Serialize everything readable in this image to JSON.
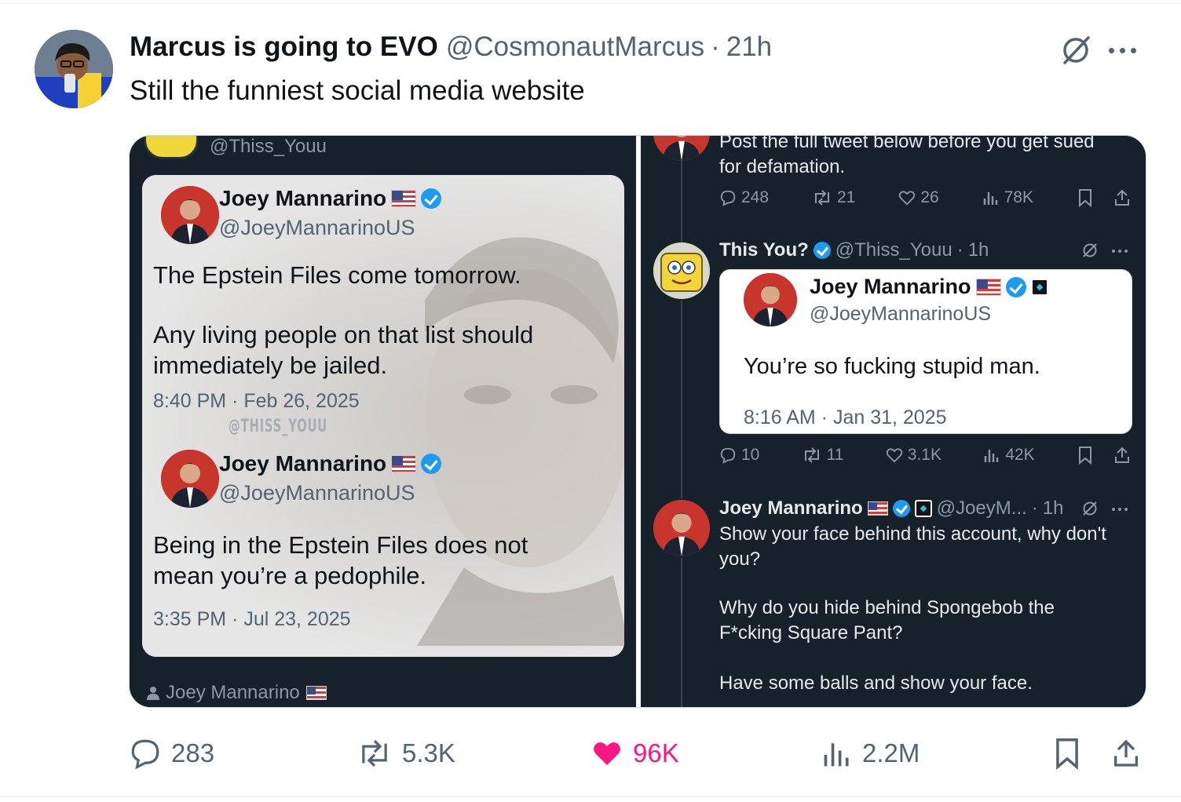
{
  "post": {
    "author_name": "Marcus is going to EVO",
    "author_handle": "@CosmonautMarcus",
    "separator": "·",
    "time": "21h",
    "text": "Still the funniest social media website"
  },
  "media": {
    "left": {
      "top_handle": "@Thiss_Youu",
      "quote1": {
        "name": "Joey Mannarino",
        "handle": "@JoeyMannarinoUS",
        "text1": "The Epstein Files come tomorrow.",
        "text2": "Any living people on that list should immediately be jailed.",
        "date": "8:40 PM · Feb 26, 2025"
      },
      "watermark": "@THISS_YOUU",
      "quote2": {
        "name": "Joey Mannarino",
        "handle": "@JoeyMannarinoUS",
        "text": "Being in the Epstein Files does not mean you’re a pedophile.",
        "date": "3:35 PM · Jul 23, 2025"
      },
      "footer_name": "Joey Mannarino"
    },
    "right": {
      "top_text": "Post the full tweet below before you get sued for defamation.",
      "top_actions": {
        "replies": "248",
        "reposts": "21",
        "likes": "26",
        "views": "78K"
      },
      "reply": {
        "name": "This You?",
        "handle": "@Thiss_Youu",
        "separator": "·",
        "time": "1h",
        "quote": {
          "name": "Joey Mannarino",
          "handle": "@JoeyMannarinoUS",
          "text": "You’re so fucking stupid man.",
          "date": "8:16 AM · Jan 31, 2025"
        },
        "actions": {
          "replies": "10",
          "reposts": "11",
          "likes": "3.1K",
          "views": "42K"
        }
      },
      "reply2": {
        "name": "Joey Mannarino",
        "handle": "@JoeyM...",
        "separator": "·",
        "time": "1h",
        "line1": "Show your face behind this account, why don't you?",
        "line2": "Why do you hide behind Spongebob the F*cking Square Pant?",
        "line3": "Have some balls and show your face."
      }
    }
  },
  "actions": {
    "replies": "283",
    "reposts": "5.3K",
    "likes": "96K",
    "views": "2.2M"
  },
  "colors": {
    "like_active": "#f91880",
    "verified": "#1d9bf0",
    "dark_bg": "#16212c",
    "muted": "#536471"
  },
  "icons": [
    "grok-icon",
    "more-icon",
    "reply-icon",
    "repost-icon",
    "heart-icon",
    "views-icon",
    "bookmark-icon",
    "share-icon",
    "flag-icon",
    "verified-icon",
    "person-icon"
  ]
}
